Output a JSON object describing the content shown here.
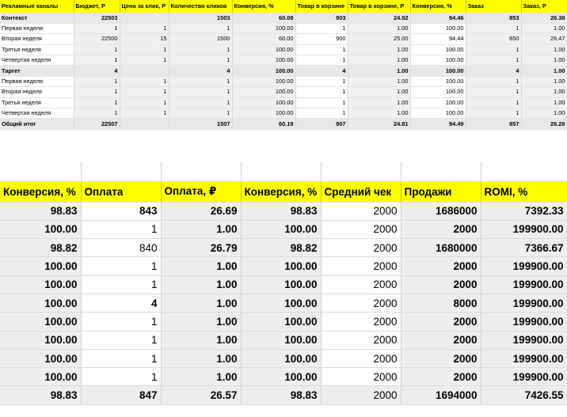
{
  "top": {
    "headers": [
      "Рекламные каналы",
      "Бюджет, Р",
      "Цена за клик, Р",
      "Количество кликов",
      "Конверсия, %",
      "Товар в корзине",
      "Товар в корзине, Р",
      "Конверсия, %",
      "Заказ",
      "Заказ, Р"
    ],
    "rows": [
      {
        "kind": "grp",
        "cells": [
          "Контекст",
          "22503",
          "",
          "1503",
          "60.08",
          "903",
          "24.92",
          "94.46",
          "853",
          "26.38"
        ]
      },
      {
        "kind": "sub",
        "cells": [
          "Первая неделя",
          "1",
          "1",
          "1",
          "100.00",
          "1",
          "1.00",
          "100.00",
          "1",
          "1.00"
        ]
      },
      {
        "kind": "sub",
        "cells": [
          "Вторая неделя",
          "22500",
          "15",
          "1500",
          "60.00",
          "900",
          "25.00",
          "94.44",
          "850",
          "26.47"
        ]
      },
      {
        "kind": "sub",
        "cells": [
          "Третья неделя",
          "1",
          "1",
          "1",
          "100.00",
          "1",
          "1.00",
          "100.00",
          "1",
          "1.00"
        ]
      },
      {
        "kind": "sub",
        "cells": [
          "Четвертая неделя",
          "1",
          "1",
          "1",
          "100.00",
          "1",
          "1.00",
          "100.00",
          "1",
          "1.00"
        ]
      },
      {
        "kind": "grp",
        "cells": [
          "Таргет",
          "4",
          "",
          "4",
          "100.00",
          "4",
          "1.00",
          "100.00",
          "4",
          "1.00"
        ]
      },
      {
        "kind": "sub",
        "cells": [
          "Первая неделя",
          "1",
          "1",
          "1",
          "100.00",
          "1",
          "1.00",
          "100.00",
          "1",
          "1.00"
        ]
      },
      {
        "kind": "sub",
        "cells": [
          "Вторая неделя",
          "1",
          "1",
          "1",
          "100.00",
          "1",
          "1.00",
          "100.00",
          "1",
          "1.00"
        ]
      },
      {
        "kind": "sub",
        "cells": [
          "Третья неделя",
          "1",
          "1",
          "1",
          "100.00",
          "1",
          "1.00",
          "100.00",
          "1",
          "1.00"
        ]
      },
      {
        "kind": "sub",
        "cells": [
          "Четвертая неделя",
          "1",
          "1",
          "1",
          "100.00",
          "1",
          "1.00",
          "100.00",
          "1",
          "1.00"
        ]
      },
      {
        "kind": "tot",
        "cells": [
          "Общий итог",
          "22507",
          "",
          "1507",
          "60.19",
          "907",
          "24.81",
          "94.49",
          "857",
          "26.26"
        ]
      }
    ]
  },
  "bottom": {
    "headers": [
      "Конверсия, %",
      "Оплата",
      "Оплата, ₽",
      "Конверсия, %",
      "Средний чек",
      "Продажи",
      "ROMI, %"
    ],
    "rows": [
      [
        "98.83",
        "843",
        "26.69",
        "98.83",
        "2000",
        "1686000",
        "7392.33"
      ],
      [
        "100.00",
        "1",
        "1.00",
        "100.00",
        "2000",
        "2000",
        "199900.00"
      ],
      [
        "98.82",
        "840",
        "26.79",
        "98.82",
        "2000",
        "1680000",
        "7366.67"
      ],
      [
        "100.00",
        "1",
        "1.00",
        "100.00",
        "2000",
        "2000",
        "199900.00"
      ],
      [
        "100.00",
        "1",
        "1.00",
        "100.00",
        "2000",
        "2000",
        "199900.00"
      ],
      [
        "100.00",
        "4",
        "1.00",
        "100.00",
        "2000",
        "8000",
        "199900.00"
      ],
      [
        "100.00",
        "1",
        "1.00",
        "100.00",
        "2000",
        "2000",
        "199900.00"
      ],
      [
        "100.00",
        "1",
        "1.00",
        "100.00",
        "2000",
        "2000",
        "199900.00"
      ],
      [
        "100.00",
        "1",
        "1.00",
        "100.00",
        "2000",
        "2000",
        "199900.00"
      ],
      [
        "100.00",
        "1",
        "1.00",
        "100.00",
        "2000",
        "2000",
        "199900.00"
      ]
    ],
    "total": [
      "98.83",
      "847",
      "26.57",
      "98.83",
      "2000",
      "1694000",
      "7426.55"
    ]
  }
}
